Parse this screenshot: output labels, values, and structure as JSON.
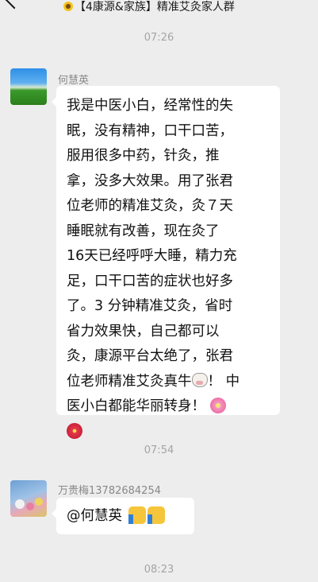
{
  "header": {
    "title": "【4康源&家族】精准艾灸家人群"
  },
  "timestamps": [
    "07:26",
    "07:54",
    "08:23"
  ],
  "messages": [
    {
      "sender": "何慧英",
      "lines": [
        "我是中医小白，经常性的失",
        "眠，没有精神，口干口苦，",
        "服用很多中药，针灸，推",
        "拿，没多大效果。用了张君",
        "位老师的精准艾灸，灸７天",
        "睡眠就有改善，现在灸了",
        "16天已经呼呼大睡，精力充",
        "足，口干口苦的症状也好多",
        "了。3 分钟精准艾灸，省时",
        "省力效果快，自己都可以",
        "灸，康源平台太绝了，张君"
      ],
      "line12_a": "位老师精准艾灸真牛",
      "line12_b": "！ 中",
      "line13": "医小白都能华丽转身！"
    },
    {
      "sender": "万贵梅13782684254",
      "text": "@何慧英"
    }
  ],
  "icons": {
    "back": "chevron-left-icon",
    "title_emoji": "sunflower-icon",
    "cow": "cow-face-icon",
    "blossom": "cherry-blossom-icon",
    "hibiscus": "hibiscus-icon",
    "thumbs": "thumbs-up-icon"
  }
}
